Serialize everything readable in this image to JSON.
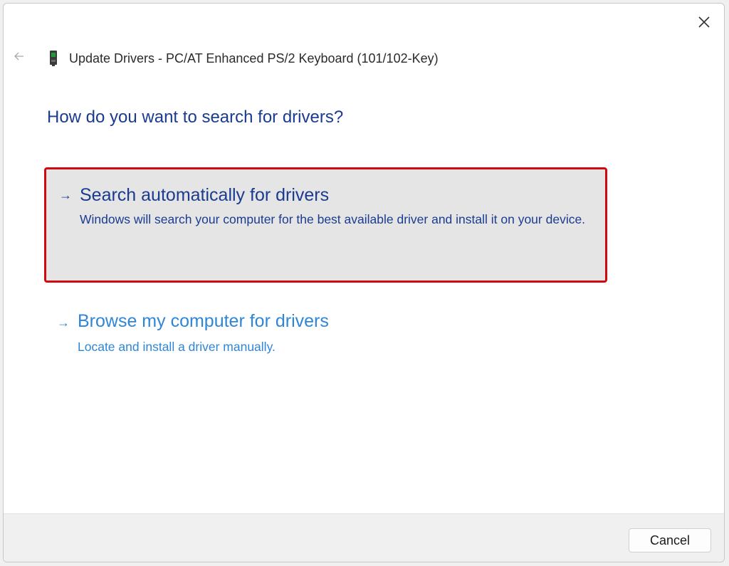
{
  "window": {
    "title": "Update Drivers - PC/AT Enhanced PS/2 Keyboard (101/102-Key)",
    "close_icon": "close-icon",
    "back_icon": "back-arrow-icon",
    "device_icon": "keyboard-device-icon"
  },
  "heading": "How do you want to search for drivers?",
  "options": [
    {
      "arrow": "→",
      "title": "Search automatically for drivers",
      "description": "Windows will search your computer for the best available driver and install it on your device.",
      "highlighted": true
    },
    {
      "arrow": "→",
      "title": "Browse my computer for drivers",
      "description": "Locate and install a driver manually.",
      "highlighted": false
    }
  ],
  "footer": {
    "cancel_label": "Cancel"
  },
  "colors": {
    "heading": "#1b3b8f",
    "link": "#2f86d6",
    "highlight_border": "#d20a10",
    "highlight_bg": "#e5e5e5"
  }
}
